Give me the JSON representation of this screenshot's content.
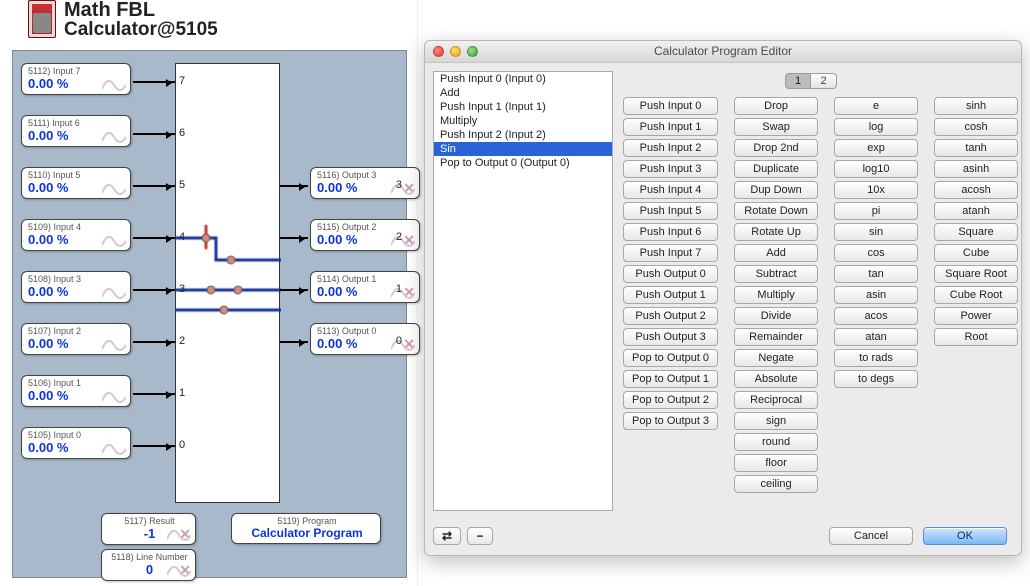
{
  "title_line1": "Math FBL",
  "title_line2": "Calculator@5105",
  "inputs": [
    {
      "tag": "5112) Input 7",
      "val": "0.00 %"
    },
    {
      "tag": "5111) Input 6",
      "val": "0.00 %"
    },
    {
      "tag": "5110) Input 5",
      "val": "0.00 %"
    },
    {
      "tag": "5109) Input 4",
      "val": "0.00 %"
    },
    {
      "tag": "5108) Input 3",
      "val": "0.00 %"
    },
    {
      "tag": "5107) Input 2",
      "val": "0.00 %"
    },
    {
      "tag": "5106) Input 1",
      "val": "0.00 %"
    },
    {
      "tag": "5105) Input 0",
      "val": "0.00 %"
    }
  ],
  "input_ports": [
    "7",
    "6",
    "5",
    "4",
    "3",
    "2",
    "1",
    "0"
  ],
  "output_ports": [
    "3",
    "2",
    "1",
    "0"
  ],
  "outputs": [
    {
      "tag": "5116) Output 3",
      "val": "0.00 %"
    },
    {
      "tag": "5115) Output 2",
      "val": "0.00 %"
    },
    {
      "tag": "5114) Output 1",
      "val": "0.00 %"
    },
    {
      "tag": "5113) Output 0",
      "val": "0.00 %"
    }
  ],
  "bottom_cards": {
    "result": {
      "tag": "5117) Result",
      "val": "-1"
    },
    "line": {
      "tag": "5118) Line Number",
      "val": "0"
    },
    "prog": {
      "tag": "5119) Program",
      "val": "Calculator Program"
    }
  },
  "editor": {
    "title": "Calculator Program Editor",
    "tabs": [
      "1",
      "2"
    ],
    "instructions": [
      "Push Input 0 (Input 0)",
      "Add",
      "Push Input 1 (Input 1)",
      "Multiply",
      "Push Input 2 (Input 2)",
      "Sin",
      "Pop to Output 0 (Output 0)"
    ],
    "selected_index": 5,
    "columns": [
      [
        "Push Input 0",
        "Push Input 1",
        "Push Input 2",
        "Push Input 3",
        "Push Input 4",
        "Push Input 5",
        "Push Input 6",
        "Push Input 7",
        "Push Output 0",
        "Push Output 1",
        "Push Output 2",
        "Push Output 3",
        "Pop to Output 0",
        "Pop to Output 1",
        "Pop to Output 2",
        "Pop to Output 3"
      ],
      [
        "Drop",
        "Swap",
        "Drop 2nd",
        "Duplicate",
        "Dup Down",
        "Rotate Down",
        "Rotate Up",
        "Add",
        "Subtract",
        "Multiply",
        "Divide",
        "Remainder",
        "Negate",
        "Absolute",
        "Reciprocal",
        "sign",
        "round",
        "floor",
        "ceiling"
      ],
      [
        "e",
        "log",
        "exp",
        "log10",
        "10x",
        "pi",
        "sin",
        "cos",
        "tan",
        "asin",
        "acos",
        "atan",
        "to rads",
        "to degs"
      ],
      [
        "sinh",
        "cosh",
        "tanh",
        "asinh",
        "acosh",
        "atanh",
        "Square",
        "Cube",
        "Square Root",
        "Cube Root",
        "Power",
        "Root"
      ]
    ],
    "util": {
      "shuffle": "⇄",
      "minus": "−"
    },
    "footer": {
      "cancel": "Cancel",
      "ok": "OK"
    }
  }
}
